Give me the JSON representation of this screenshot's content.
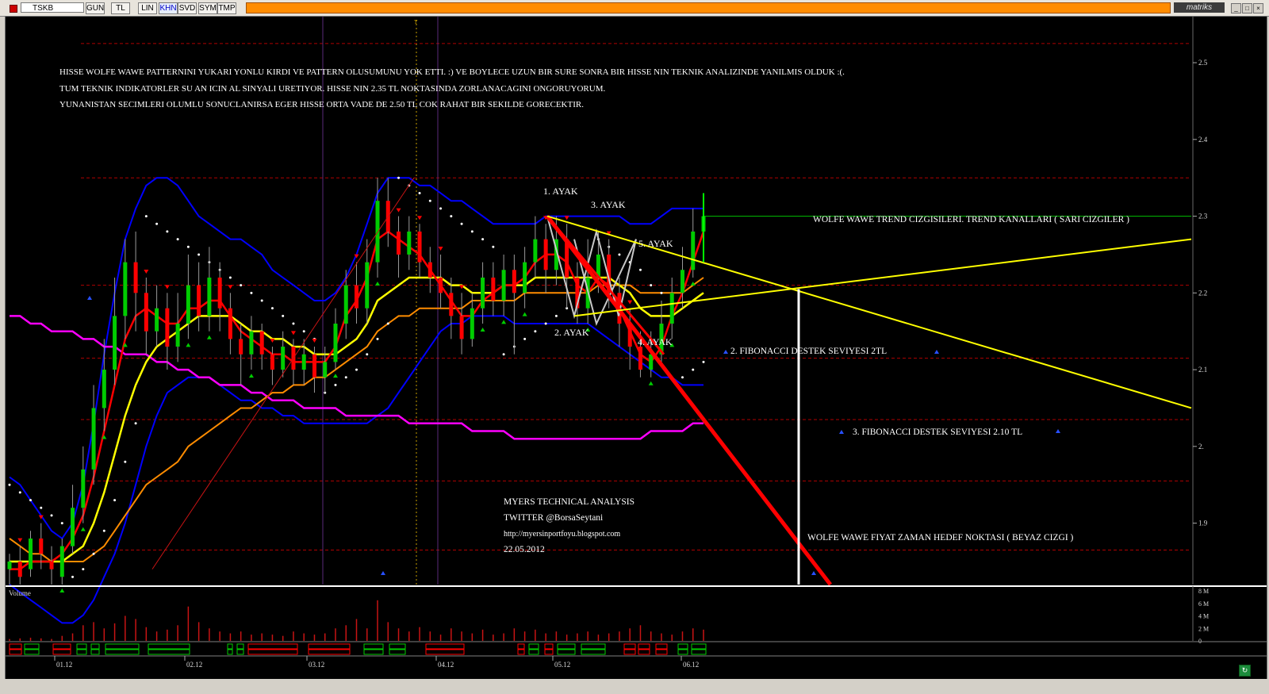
{
  "toolbar": {
    "symbol": "TSKB",
    "buttons": [
      "GUN",
      "TL",
      "LIN",
      "KHN",
      "SVD",
      "SYM",
      "TMP"
    ],
    "active_button": "KHN",
    "brand": "matriks"
  },
  "colors": {
    "background": "#000000",
    "bull_candle": "#00cc00",
    "bear_candle": "#ff0000",
    "bollinger": "#0000ff",
    "ma_short": "#ff0000",
    "ma_mid": "#ffff00",
    "ma_long": "#ff8c00",
    "ma_longest": "#ff00ff",
    "sar": "#ffffff",
    "trend_lines": "#ffff00",
    "target_line": "#ffffff",
    "resistance": "#00c000"
  },
  "chart_data": {
    "type": "candlestick",
    "y_ticks": [
      "2.5",
      "2.4",
      "2.3",
      "2.2",
      "2.1",
      "2.",
      "1.9"
    ],
    "ylim": [
      1.82,
      2.56
    ],
    "x_ticks": [
      "01.12",
      "02.12",
      "03.12",
      "04.12",
      "05.12",
      "06.12"
    ],
    "volume_label": "Volume",
    "volume_ticks": [
      "8 M",
      "6 M",
      "4 M",
      "2 M",
      "0"
    ],
    "volume_max": 8,
    "notes": [
      "HISSE WOLFE WAWE PATTERNINI YUKARI YONLU KIRDI VE PATTERN OLUSUMUNU YOK ETTI. :) VE BOYLECE UZUN BIR SURE SONRA BIR HISSE NIN TEKNIK ANALIZINDE YANILMIS OLDUK :(.",
      "TUM TEKNIK INDIKATORLER SU AN ICIN AL SINYALI URETIYOR. HISSE NIN 2.35 TL NOKTASINDA ZORLANACAGINI ONGORUYORUM.",
      "YUNANISTAN SECIMLERI OLUMLU SONUCLANIRSA EGER HISSE ORTA  VADE DE 2.50 TL  COK RAHAT BIR SEKILDE GORECEKTIR."
    ],
    "wave_labels": [
      "1. AYAK",
      "2. AYAK",
      "3. AYAK",
      "4. AYAK",
      "5. AYAK"
    ],
    "annotations": {
      "trend": "WOLFE WAWE TREND CIZGISILERI. TREND KANALLARI ( SARI CIZGILER )",
      "fib2": "2. FIBONACCI DESTEK SEVIYESI 2TL",
      "fib3": "3. FIBONACCI DESTEK SEVIYESI 2.10 TL",
      "target": "WOLFE WAWE FIYAT ZAMAN HEDEF NOKTASI ( BEYAZ CIZGI )"
    },
    "credits": [
      "MYERS TECHNICAL ANALYSIS",
      "TWITTER @BorsaSeytani",
      "http://myersinportfoyu.blogspot.com",
      "22.05.2012"
    ],
    "grid_levels": [
      2.525,
      2.35,
      2.21,
      2.115,
      2.035,
      1.955,
      1.865
    ],
    "resistance_level": 2.3,
    "candles": [
      [
        1.84,
        1.85,
        1.82,
        1.86
      ],
      [
        1.85,
        1.83,
        1.82,
        1.87
      ],
      [
        1.84,
        1.88,
        1.83,
        1.89
      ],
      [
        1.88,
        1.86,
        1.84,
        1.9
      ],
      [
        1.85,
        1.84,
        1.82,
        1.87
      ],
      [
        1.83,
        1.87,
        1.82,
        1.88
      ],
      [
        1.87,
        1.92,
        1.86,
        1.95
      ],
      [
        1.92,
        1.97,
        1.9,
        2.0
      ],
      [
        1.97,
        2.05,
        1.95,
        2.08
      ],
      [
        2.05,
        2.1,
        2.02,
        2.14
      ],
      [
        2.1,
        2.17,
        2.08,
        2.22
      ],
      [
        2.17,
        2.24,
        2.14,
        2.27
      ],
      [
        2.24,
        2.2,
        2.15,
        2.28
      ],
      [
        2.2,
        2.15,
        2.12,
        2.22
      ],
      [
        2.15,
        2.18,
        2.13,
        2.21
      ],
      [
        2.18,
        2.13,
        2.1,
        2.2
      ],
      [
        2.13,
        2.16,
        2.11,
        2.2
      ],
      [
        2.16,
        2.21,
        2.14,
        2.25
      ],
      [
        2.21,
        2.17,
        2.15,
        2.24
      ],
      [
        2.17,
        2.22,
        2.15,
        2.26
      ],
      [
        2.22,
        2.18,
        2.15,
        2.24
      ],
      [
        2.18,
        2.14,
        2.12,
        2.2
      ],
      [
        2.14,
        2.12,
        2.08,
        2.16
      ],
      [
        2.12,
        2.15,
        2.1,
        2.17
      ],
      [
        2.15,
        2.12,
        2.1,
        2.16
      ],
      [
        2.12,
        2.1,
        2.08,
        2.13
      ],
      [
        2.1,
        2.13,
        2.09,
        2.15
      ],
      [
        2.13,
        2.1,
        2.08,
        2.14
      ],
      [
        2.1,
        2.12,
        2.08,
        2.14
      ],
      [
        2.12,
        2.09,
        2.07,
        2.13
      ],
      [
        2.09,
        2.11,
        2.07,
        2.13
      ],
      [
        2.11,
        2.16,
        2.1,
        2.18
      ],
      [
        2.16,
        2.21,
        2.14,
        2.23
      ],
      [
        2.21,
        2.18,
        2.16,
        2.24
      ],
      [
        2.18,
        2.24,
        2.16,
        2.27
      ],
      [
        2.24,
        2.32,
        2.22,
        2.35
      ],
      [
        2.32,
        2.28,
        2.26,
        2.35
      ],
      [
        2.28,
        2.25,
        2.22,
        2.3
      ],
      [
        2.25,
        2.28,
        2.23,
        2.3
      ],
      [
        2.28,
        2.24,
        2.22,
        2.29
      ],
      [
        2.24,
        2.22,
        2.2,
        2.26
      ],
      [
        2.22,
        2.2,
        2.18,
        2.25
      ],
      [
        2.2,
        2.17,
        2.14,
        2.22
      ],
      [
        2.17,
        2.14,
        2.12,
        2.2
      ],
      [
        2.14,
        2.18,
        2.13,
        2.2
      ],
      [
        2.18,
        2.22,
        2.16,
        2.24
      ],
      [
        2.22,
        2.19,
        2.17,
        2.24
      ],
      [
        2.19,
        2.23,
        2.17,
        2.25
      ],
      [
        2.23,
        2.2,
        2.12,
        2.25
      ],
      [
        2.2,
        2.24,
        2.18,
        2.26
      ],
      [
        2.24,
        2.27,
        2.22,
        2.3
      ],
      [
        2.27,
        2.23,
        2.2,
        2.29
      ],
      [
        2.23,
        2.27,
        2.21,
        2.3
      ],
      [
        2.27,
        2.22,
        2.18,
        2.29
      ],
      [
        2.22,
        2.18,
        2.16,
        2.24
      ],
      [
        2.18,
        2.22,
        2.16,
        2.27
      ],
      [
        2.22,
        2.25,
        2.2,
        2.28
      ],
      [
        2.25,
        2.2,
        2.18,
        2.27
      ],
      [
        2.2,
        2.16,
        2.13,
        2.22
      ],
      [
        2.16,
        2.13,
        2.1,
        2.18
      ],
      [
        2.13,
        2.1,
        2.09,
        2.15
      ],
      [
        2.1,
        2.12,
        2.09,
        2.15
      ],
      [
        2.12,
        2.16,
        2.11,
        2.19
      ],
      [
        2.16,
        2.2,
        2.14,
        2.22
      ],
      [
        2.2,
        2.23,
        2.18,
        2.26
      ],
      [
        2.23,
        2.28,
        2.22,
        2.31
      ],
      [
        2.28,
        2.3,
        2.26,
        2.33
      ]
    ],
    "volumes": [
      0.3,
      0.4,
      0.5,
      0.4,
      0.3,
      0.8,
      1.2,
      2.5,
      3.0,
      2.0,
      2.8,
      4.0,
      3.5,
      2.2,
      1.5,
      1.8,
      2.5,
      5.5,
      3.0,
      2.0,
      1.5,
      1.2,
      1.5,
      1.0,
      1.2,
      1.0,
      0.8,
      1.5,
      1.2,
      1.0,
      1.2,
      2.0,
      2.5,
      3.5,
      2.0,
      6.5,
      3.0,
      2.0,
      1.5,
      2.2,
      1.5,
      1.0,
      2.0,
      1.5,
      1.2,
      1.8,
      1.0,
      1.2,
      2.0,
      1.5,
      1.8,
      1.2,
      1.5,
      1.0,
      1.2,
      1.5,
      1.0,
      1.2,
      1.5,
      2.0,
      2.5,
      1.5,
      1.2,
      1.0,
      1.5,
      2.0,
      1.8
    ],
    "indicators": {
      "ma_short": [
        1.84,
        1.84,
        1.85,
        1.85,
        1.85,
        1.86,
        1.88,
        1.91,
        1.96,
        2.02,
        2.08,
        2.14,
        2.17,
        2.18,
        2.17,
        2.16,
        2.16,
        2.18,
        2.18,
        2.19,
        2.19,
        2.17,
        2.15,
        2.14,
        2.13,
        2.12,
        2.12,
        2.11,
        2.11,
        2.11,
        2.11,
        2.13,
        2.17,
        2.19,
        2.22,
        2.27,
        2.28,
        2.27,
        2.26,
        2.25,
        2.23,
        2.21,
        2.19,
        2.17,
        2.17,
        2.19,
        2.2,
        2.21,
        2.21,
        2.22,
        2.24,
        2.25,
        2.25,
        2.24,
        2.21,
        2.2,
        2.22,
        2.21,
        2.18,
        2.15,
        2.12,
        2.11,
        2.13,
        2.17,
        2.2,
        2.24,
        2.28
      ],
      "ma_mid": [
        1.85,
        1.85,
        1.85,
        1.85,
        1.85,
        1.85,
        1.86,
        1.87,
        1.9,
        1.94,
        1.99,
        2.04,
        2.08,
        2.11,
        2.13,
        2.14,
        2.15,
        2.16,
        2.17,
        2.17,
        2.17,
        2.17,
        2.16,
        2.15,
        2.15,
        2.14,
        2.14,
        2.13,
        2.13,
        2.12,
        2.12,
        2.12,
        2.13,
        2.14,
        2.16,
        2.19,
        2.2,
        2.21,
        2.22,
        2.22,
        2.22,
        2.22,
        2.21,
        2.21,
        2.2,
        2.2,
        2.2,
        2.21,
        2.21,
        2.21,
        2.22,
        2.22,
        2.22,
        2.22,
        2.22,
        2.22,
        2.22,
        2.22,
        2.21,
        2.2,
        2.18,
        2.17,
        2.17,
        2.17,
        2.18,
        2.19,
        2.2
      ],
      "ma_long": [
        1.88,
        1.87,
        1.86,
        1.86,
        1.85,
        1.85,
        1.85,
        1.85,
        1.86,
        1.87,
        1.89,
        1.91,
        1.93,
        1.95,
        1.96,
        1.97,
        1.98,
        2.0,
        2.01,
        2.02,
        2.03,
        2.04,
        2.05,
        2.05,
        2.06,
        2.07,
        2.07,
        2.08,
        2.08,
        2.09,
        2.09,
        2.1,
        2.11,
        2.12,
        2.13,
        2.15,
        2.16,
        2.17,
        2.17,
        2.18,
        2.18,
        2.18,
        2.18,
        2.18,
        2.19,
        2.19,
        2.19,
        2.19,
        2.19,
        2.2,
        2.2,
        2.2,
        2.2,
        2.2,
        2.2,
        2.2,
        2.21,
        2.21,
        2.21,
        2.21,
        2.2,
        2.2,
        2.2,
        2.2,
        2.2,
        2.21,
        2.22
      ],
      "ma_longest": [
        2.17,
        2.17,
        2.16,
        2.16,
        2.15,
        2.15,
        2.15,
        2.14,
        2.14,
        2.13,
        2.13,
        2.12,
        2.12,
        2.12,
        2.11,
        2.11,
        2.1,
        2.1,
        2.09,
        2.09,
        2.08,
        2.08,
        2.08,
        2.07,
        2.07,
        2.06,
        2.06,
        2.06,
        2.05,
        2.05,
        2.05,
        2.05,
        2.04,
        2.04,
        2.04,
        2.04,
        2.04,
        2.04,
        2.03,
        2.03,
        2.03,
        2.03,
        2.03,
        2.03,
        2.02,
        2.02,
        2.02,
        2.02,
        2.01,
        2.01,
        2.01,
        2.01,
        2.01,
        2.01,
        2.01,
        2.01,
        2.01,
        2.01,
        2.01,
        2.01,
        2.01,
        2.02,
        2.02,
        2.02,
        2.02,
        2.03,
        2.03
      ],
      "bb_upper": [
        1.96,
        1.95,
        1.93,
        1.91,
        1.89,
        1.88,
        1.9,
        1.95,
        2.03,
        2.12,
        2.2,
        2.27,
        2.31,
        2.34,
        2.35,
        2.35,
        2.34,
        2.32,
        2.3,
        2.29,
        2.28,
        2.27,
        2.27,
        2.26,
        2.25,
        2.23,
        2.22,
        2.21,
        2.2,
        2.19,
        2.19,
        2.2,
        2.22,
        2.25,
        2.29,
        2.33,
        2.35,
        2.35,
        2.35,
        2.34,
        2.34,
        2.33,
        2.32,
        2.32,
        2.31,
        2.3,
        2.29,
        2.29,
        2.29,
        2.29,
        2.29,
        2.3,
        2.3,
        2.3,
        2.3,
        2.3,
        2.3,
        2.3,
        2.3,
        2.29,
        2.29,
        2.29,
        2.3,
        2.31,
        2.31,
        2.31,
        2.31
      ],
      "bb_lower": [
        1.82,
        1.81,
        1.8,
        1.79,
        1.78,
        1.77,
        1.77,
        1.78,
        1.8,
        1.83,
        1.86,
        1.9,
        1.95,
        2.0,
        2.04,
        2.07,
        2.08,
        2.09,
        2.09,
        2.09,
        2.08,
        2.07,
        2.06,
        2.06,
        2.05,
        2.05,
        2.04,
        2.04,
        2.03,
        2.03,
        2.03,
        2.03,
        2.03,
        2.03,
        2.03,
        2.04,
        2.05,
        2.07,
        2.09,
        2.11,
        2.13,
        2.15,
        2.16,
        2.16,
        2.17,
        2.17,
        2.17,
        2.17,
        2.16,
        2.16,
        2.16,
        2.16,
        2.16,
        2.16,
        2.16,
        2.16,
        2.15,
        2.14,
        2.13,
        2.12,
        2.11,
        2.1,
        2.09,
        2.09,
        2.08,
        2.08,
        2.08
      ],
      "sar": [
        1.95,
        1.94,
        1.93,
        1.92,
        1.91,
        1.9,
        1.83,
        1.84,
        1.86,
        1.89,
        1.93,
        1.98,
        2.03,
        2.3,
        2.29,
        2.28,
        2.27,
        2.26,
        2.25,
        2.24,
        2.23,
        2.22,
        2.21,
        2.2,
        2.19,
        2.18,
        2.17,
        2.16,
        2.15,
        2.14,
        2.07,
        2.08,
        2.09,
        2.1,
        2.12,
        2.14,
        2.16,
        2.35,
        2.34,
        2.33,
        2.32,
        2.31,
        2.3,
        2.29,
        2.28,
        2.27,
        2.26,
        2.12,
        2.13,
        2.14,
        2.15,
        2.16,
        2.17,
        2.18,
        2.19,
        2.2,
        2.27,
        2.26,
        2.25,
        2.24,
        2.23,
        2.21,
        2.2,
        2.18,
        2.09,
        2.1,
        2.11
      ]
    }
  }
}
